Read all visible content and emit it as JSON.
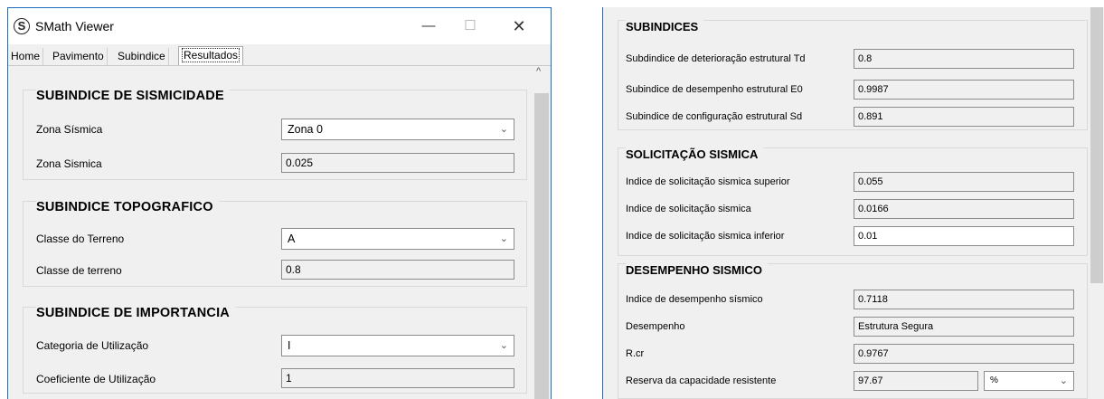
{
  "left_window": {
    "app_icon_letter": "S",
    "title": "SMath Viewer",
    "controls": {
      "minimize": "—",
      "maximize": "☐",
      "close": "✕"
    },
    "tabs": [
      "Home",
      "Pavimento",
      "Subindice",
      "Resultados"
    ],
    "active_tab": "Resultados",
    "scroll_up_glyph": "^",
    "groups": {
      "sismicidade": {
        "title": "SUBINDICE DE SISMICIDADE",
        "zona_sismica_combo": {
          "label": "Zona Sísmica",
          "value": "Zona 0"
        },
        "zona_sismica_value": {
          "label": "Zona Sismica",
          "value": "0.025"
        }
      },
      "topografico": {
        "title": "SUBINDICE TOPOGRAFICO",
        "classe_combo": {
          "label": "Classe do Terreno",
          "value": "A"
        },
        "classe_value": {
          "label": "Classe de terreno",
          "value": "0.8"
        }
      },
      "importancia": {
        "title": "SUBINDICE DE IMPORTANCIA",
        "categoria_combo": {
          "label": "Categoria de Utilização",
          "value": "I"
        },
        "coeficiente_value": {
          "label": "Coeficiente de Utilização",
          "value": "1"
        }
      }
    }
  },
  "right_window": {
    "subindices": {
      "title": "SUBINDICES",
      "rows": [
        {
          "label": "Subdindice de deterioração estrutural Td",
          "value": "0.8"
        },
        {
          "label": "Subindice de desempenho estrutural E0",
          "value": "0.9987"
        },
        {
          "label": "Subindice de configuração estrutural Sd",
          "value": "0.891"
        }
      ]
    },
    "solicitacao": {
      "title": "SOLICITAÇÃO SISMICA",
      "rows": [
        {
          "label": "Indice de solicitação sismica superior",
          "value": "0.055"
        },
        {
          "label": "Indice de solicitação sismica",
          "value": "0.0166"
        },
        {
          "label": "Indice de solicitação sismica inferior",
          "value": "0.01"
        }
      ]
    },
    "desempenho": {
      "title": "DESEMPENHO SISMICO",
      "rows": [
        {
          "label": "Indice de desempenho sísmico",
          "value": "0.7118"
        },
        {
          "label": "Desempenho",
          "value": "Estrutura Segura"
        },
        {
          "label": "R.cr",
          "value": "0.9767"
        },
        {
          "label": "Reserva da capacidade resistente",
          "value": "97.67",
          "unit": "%"
        }
      ]
    }
  },
  "colors": {
    "window_border": "#1c6bbf",
    "panel_bg": "#f0f0f0",
    "field_border": "#8c8c8c"
  },
  "icons": {
    "dropdown": "chevron-down-icon",
    "app": "smath-logo-icon"
  }
}
